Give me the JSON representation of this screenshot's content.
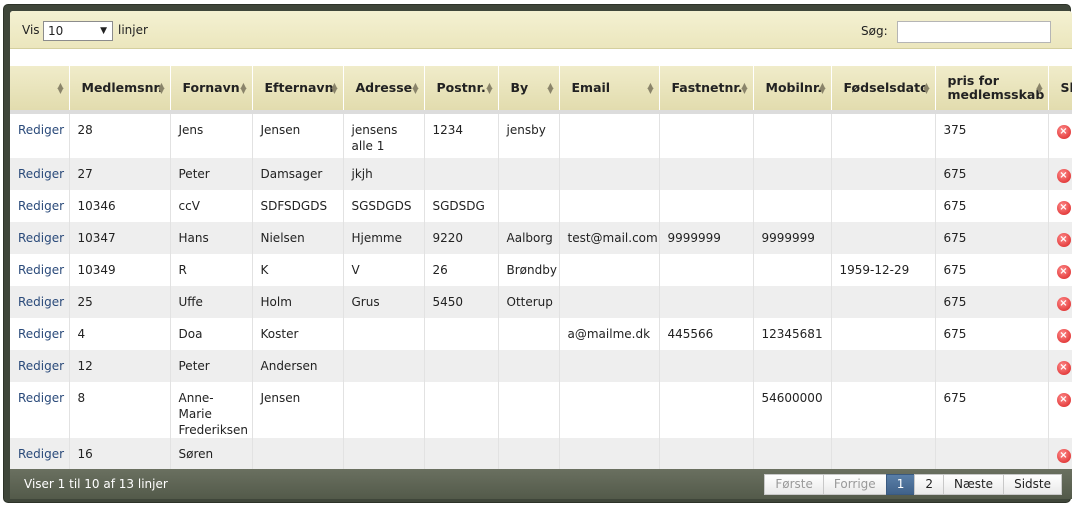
{
  "toolbar": {
    "length_label": "Vis",
    "length_value": "10",
    "length_suffix": "linjer",
    "search_label": "Søg:",
    "search_value": ""
  },
  "columns": [
    "",
    "Medlemsnr.",
    "Fornavn",
    "Efternavn",
    "Adresse",
    "Postnr.",
    "By",
    "Email",
    "Fastnetnr.",
    "Mobilnr.",
    "Fødselsdato",
    "pris for medlemsskab",
    "Sl"
  ],
  "rows": [
    {
      "edit": "Rediger",
      "nr": "28",
      "fornavn": "Jens",
      "efternavn": "Jensen",
      "adresse": "jensens alle 1",
      "postnr": "1234",
      "by": "jensby",
      "email": "",
      "fastnet": "",
      "mobil": "",
      "foedsel": "",
      "pris": "375"
    },
    {
      "edit": "Rediger",
      "nr": "27",
      "fornavn": "Peter",
      "efternavn": "Damsager",
      "adresse": "jkjh",
      "postnr": "",
      "by": "",
      "email": "",
      "fastnet": "",
      "mobil": "",
      "foedsel": "",
      "pris": "675"
    },
    {
      "edit": "Rediger",
      "nr": "10346",
      "fornavn": "ccV",
      "efternavn": "SDFSDGDS",
      "adresse": "SGSDGDS",
      "postnr": "SGDSDG",
      "by": "",
      "email": "",
      "fastnet": "",
      "mobil": "",
      "foedsel": "",
      "pris": "675"
    },
    {
      "edit": "Rediger",
      "nr": "10347",
      "fornavn": "Hans",
      "efternavn": "Nielsen",
      "adresse": "Hjemme",
      "postnr": "9220",
      "by": "Aalborg",
      "email": "test@mail.com",
      "fastnet": "9999999",
      "mobil": "9999999",
      "foedsel": "",
      "pris": "675"
    },
    {
      "edit": "Rediger",
      "nr": "10349",
      "fornavn": "R",
      "efternavn": "K",
      "adresse": "V",
      "postnr": "26",
      "by": "Brøndby",
      "email": "",
      "fastnet": "",
      "mobil": "",
      "foedsel": "1959-12-29",
      "pris": "675"
    },
    {
      "edit": "Rediger",
      "nr": "25",
      "fornavn": "Uffe",
      "efternavn": "Holm",
      "adresse": "Grus",
      "postnr": "5450",
      "by": "Otterup",
      "email": "",
      "fastnet": "",
      "mobil": "",
      "foedsel": "",
      "pris": "675"
    },
    {
      "edit": "Rediger",
      "nr": "4",
      "fornavn": "Doa",
      "efternavn": "Koster",
      "adresse": "",
      "postnr": "",
      "by": "",
      "email": "a@mailme.dk",
      "fastnet": "445566",
      "mobil": "12345681",
      "foedsel": "",
      "pris": "675"
    },
    {
      "edit": "Rediger",
      "nr": "12",
      "fornavn": "Peter",
      "efternavn": "Andersen",
      "adresse": "",
      "postnr": "",
      "by": "",
      "email": "",
      "fastnet": "",
      "mobil": "",
      "foedsel": "",
      "pris": ""
    },
    {
      "edit": "Rediger",
      "nr": "8",
      "fornavn": "Anne-Marie Frederiksen",
      "efternavn": "Jensen",
      "adresse": "",
      "postnr": "",
      "by": "",
      "email": "",
      "fastnet": "",
      "mobil": "54600000",
      "foedsel": "",
      "pris": "675"
    },
    {
      "edit": "Rediger",
      "nr": "16",
      "fornavn": "Søren",
      "efternavn": "",
      "adresse": "",
      "postnr": "",
      "by": "",
      "email": "",
      "fastnet": "",
      "mobil": "",
      "foedsel": "",
      "pris": ""
    }
  ],
  "footer": {
    "info": "Viser 1 til 10 af 13 linjer",
    "first": "Første",
    "prev": "Forrige",
    "page1": "1",
    "page2": "2",
    "next": "Næste",
    "last": "Sidste"
  },
  "icons": {
    "delete": "delete-circle-icon",
    "sort": "sort-both-icon"
  },
  "colors": {
    "header_bg": "#ebe6bd",
    "frame": "#3f463a",
    "active_page": "#4b6f99",
    "delete_red": "#d92020"
  }
}
